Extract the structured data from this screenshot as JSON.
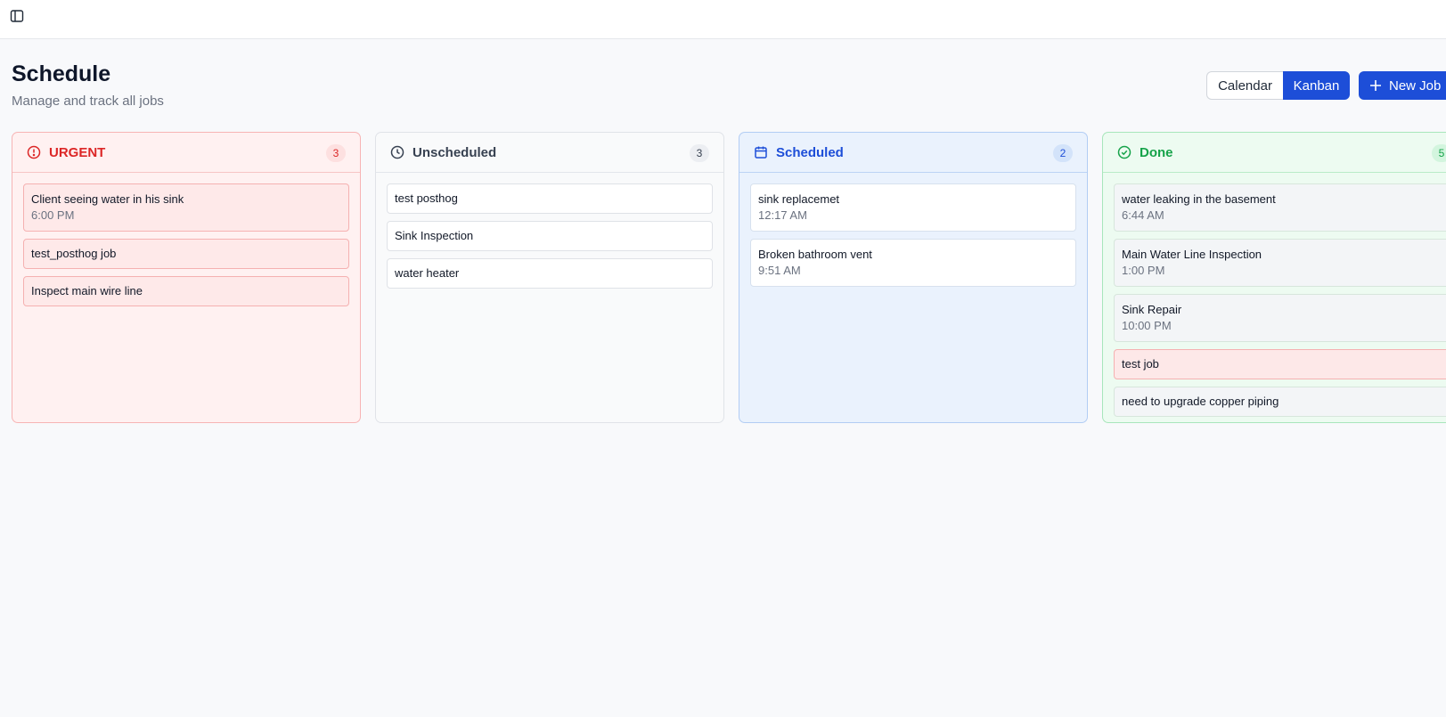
{
  "header": {
    "title": "Schedule",
    "subtitle": "Manage and track all jobs",
    "view_calendar": "Calendar",
    "view_kanban": "Kanban",
    "new_job": "New Job"
  },
  "columns": {
    "urgent": {
      "title": "URGENT",
      "count": "3",
      "cards": [
        {
          "title": "Client seeing water in his sink",
          "time": "6:00 PM"
        },
        {
          "title": "test_posthog job",
          "time": ""
        },
        {
          "title": "Inspect main wire line",
          "time": ""
        }
      ]
    },
    "unscheduled": {
      "title": "Unscheduled",
      "count": "3",
      "cards": [
        {
          "title": "test posthog",
          "time": ""
        },
        {
          "title": "Sink Inspection",
          "time": ""
        },
        {
          "title": "water heater",
          "time": ""
        }
      ]
    },
    "scheduled": {
      "title": "Scheduled",
      "count": "2",
      "cards": [
        {
          "title": "sink replacemet",
          "time": "12:17 AM"
        },
        {
          "title": "Broken bathroom vent",
          "time": "9:51 AM"
        }
      ]
    },
    "done": {
      "title": "Done",
      "count": "5",
      "cards": [
        {
          "title": "water leaking in the basement",
          "time": "6:44 AM"
        },
        {
          "title": "Main Water Line Inspection",
          "time": "1:00 PM"
        },
        {
          "title": "Sink Repair",
          "time": "10:00 PM"
        },
        {
          "title": "test job",
          "time": ""
        },
        {
          "title": "need to upgrade copper piping",
          "time": ""
        }
      ]
    }
  },
  "colors": {
    "accent": "#1d4ed8",
    "urgent": "#dc2626",
    "done": "#16a34a"
  }
}
